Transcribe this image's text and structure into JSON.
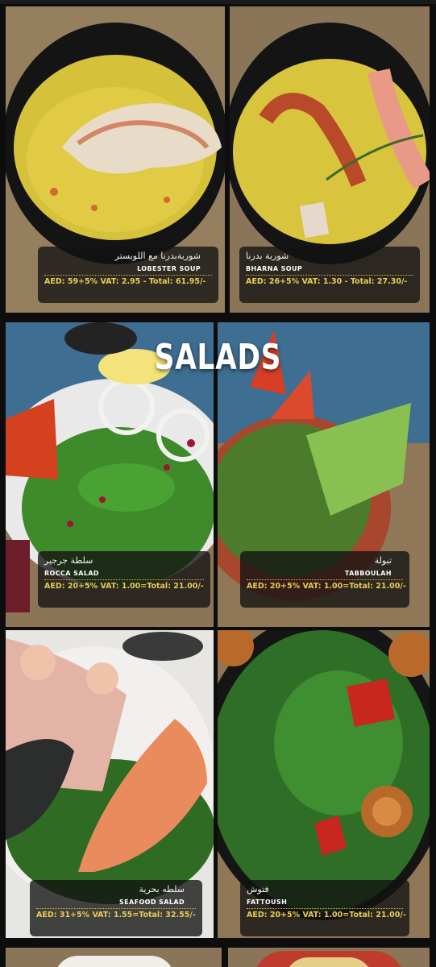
{
  "section_title": "SALADS",
  "soups": [
    {
      "arabic": "شوربةبدرنا مع اللوبستر",
      "english": "LOBESTER SOUP",
      "price": "AED: 59+5% VAT: 2.95 - Total: 61.95/-"
    },
    {
      "arabic": "شوربة بدرنا",
      "english": "BHARNA SOUP",
      "price": "AED: 26+5% VAT: 1.30 - Total: 27.30/-"
    }
  ],
  "salads": [
    {
      "arabic": "سلطة جرجير",
      "english": "ROCCA SALAD",
      "price": "AED: 20+5% VAT: 1.00=Total: 21.00/-"
    },
    {
      "arabic": "تبولة",
      "english": "TABBOULAH",
      "price": "AED: 20+5% VAT: 1.00=Total: 21.00/-"
    },
    {
      "arabic": "سلطه بحرية",
      "english": "SEAFOOD SALAD",
      "price": "AED: 31+5% VAT: 1.55=Total: 32.55/-"
    },
    {
      "arabic": "فتوش",
      "english": "FATTOUSH",
      "price": "AED: 20+5% VAT: 1.00=Total: 21.00/-"
    }
  ]
}
